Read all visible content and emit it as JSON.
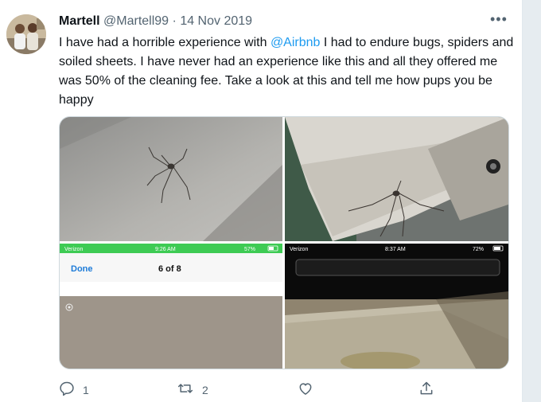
{
  "tweet": {
    "display_name": "Martell",
    "handle": "@Martell99",
    "separator": "·",
    "date": "14 Nov 2019",
    "more_icon": "more-horizontal-icon",
    "text_before": "I have had a horrible experience with ",
    "mention": "@Airbnb",
    "text_after": " I had to endure bugs, spiders and soiled sheets. I have never had an experience like this and all they offered me was 50% of the cleaning fee. Take a look at this and tell me how pups you be happy"
  },
  "photos": {
    "photo3": {
      "carrier": "Verizon",
      "time": "9:26 AM",
      "battery": "57%",
      "done_label": "Done",
      "counter": "6 of 8"
    },
    "photo4": {
      "carrier": "Verizon",
      "time": "8:37 AM",
      "battery": "72%"
    }
  },
  "actions": {
    "reply_count": "1",
    "retweet_count": "2",
    "like_count": "",
    "share_count": ""
  },
  "colors": {
    "accent": "#1d9bf0",
    "text": "#0f1419",
    "muted": "#536471",
    "ios_green": "#3ecb54"
  }
}
